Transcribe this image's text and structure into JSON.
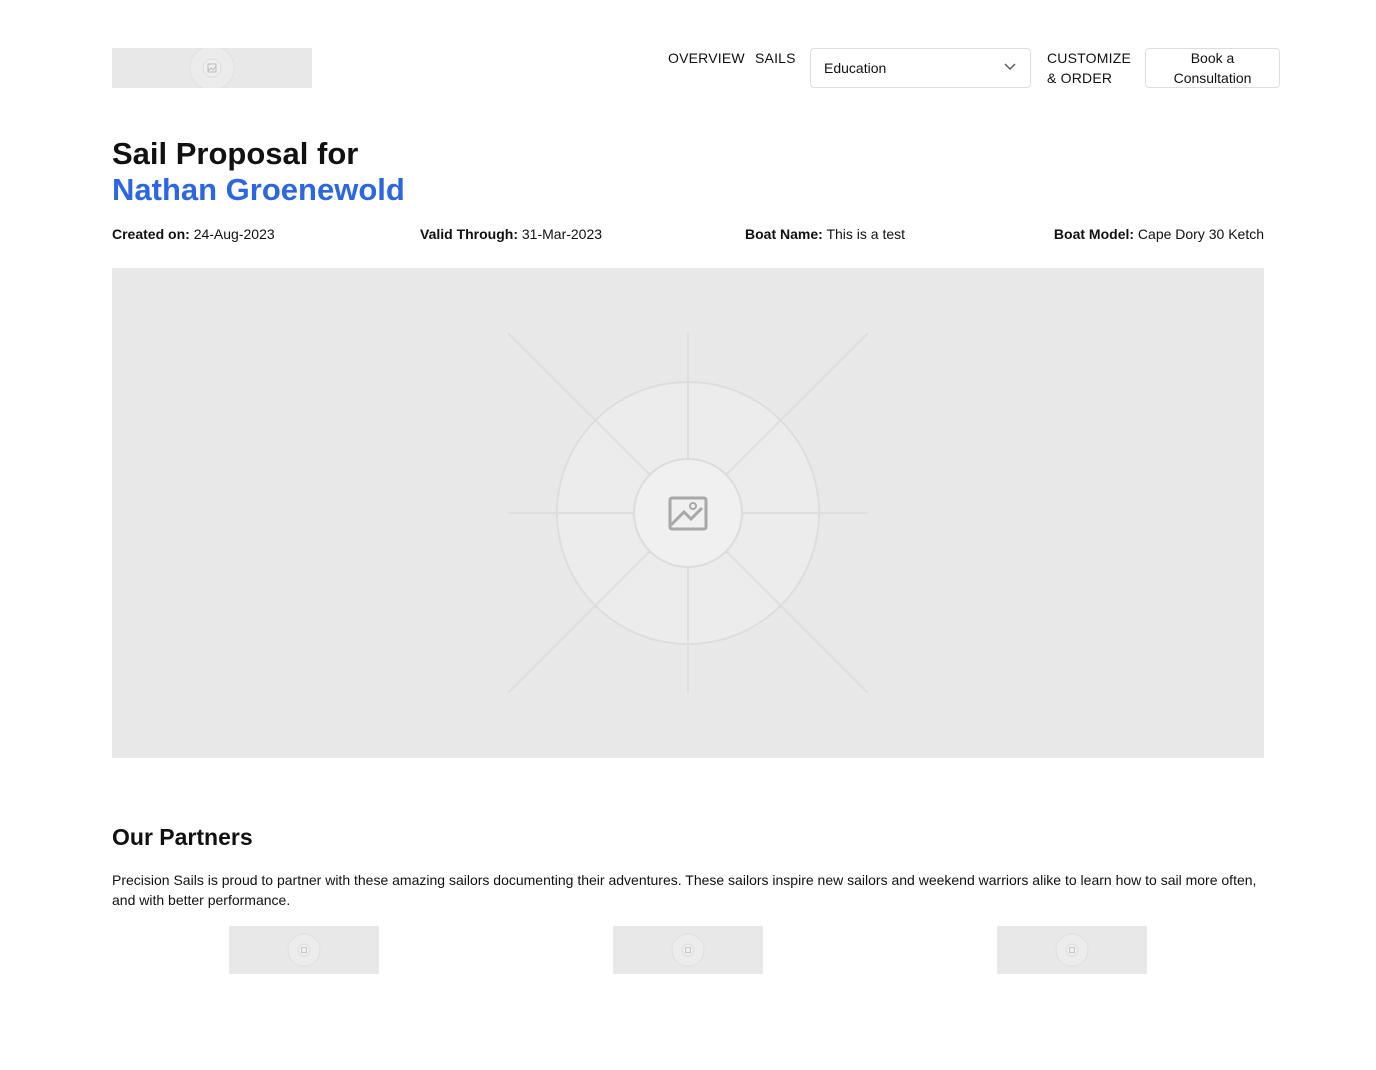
{
  "header": {
    "logo_icon": "image-placeholder-icon",
    "nav": {
      "overview": "OVERVIEW",
      "sails": "SAILS",
      "education_select": "Education",
      "customize_line1": "CUSTOMIZE",
      "customize_line2": "& ORDER",
      "consult_line1": "Book a",
      "consult_line2": "Consultation"
    }
  },
  "proposal": {
    "title_line1": "Sail Proposal for",
    "customer_name": "Nathan Groenewold",
    "accent_color": "#2c66e0",
    "meta": {
      "created_label": "Created on:",
      "created_value": "24-Aug-2023",
      "valid_label": "Valid Through:",
      "valid_value": "31-Mar-2023",
      "boat_name_label": "Boat Name:",
      "boat_name_value": "This is a test",
      "boat_model_label": "Boat Model:",
      "boat_model_value": "Cape Dory 30 Ketch"
    },
    "hero_icon": "image-placeholder-icon"
  },
  "partners": {
    "title": "Our Partners",
    "description": "Precision Sails is proud to partner with these amazing sailors documenting their adventures. These sailors inspire new sailors and weekend warriors alike to learn how to sail more often, and with better performance.",
    "logos": [
      "image-placeholder-icon",
      "image-placeholder-icon",
      "image-placeholder-icon"
    ]
  }
}
